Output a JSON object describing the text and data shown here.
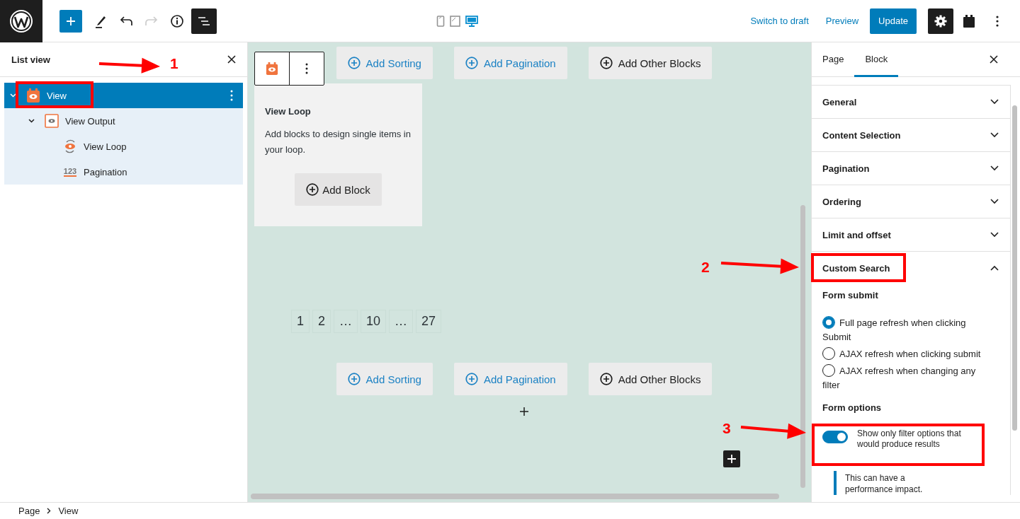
{
  "toolbar": {
    "redo": {
      "disabled": true
    },
    "list_view": {
      "on": true
    },
    "devices": [
      {
        "kind": "mobile",
        "selected": false
      },
      {
        "kind": "tablet",
        "selected": false
      },
      {
        "kind": "desktop",
        "selected": true
      }
    ],
    "actions": [
      {
        "label": "Switch to draft",
        "kind": "link"
      },
      {
        "label": "Preview",
        "kind": "link"
      },
      {
        "label": "Update",
        "kind": "primary"
      }
    ],
    "settings": {
      "on": true
    }
  },
  "list_view": {
    "title": "List view",
    "items": [
      {
        "label": "View",
        "kind": "view",
        "selected": true,
        "expanded": true,
        "children": [
          {
            "label": "View Output",
            "kind": "output",
            "selected": false,
            "expanded": true,
            "children": [
              {
                "label": "View Loop",
                "kind": "loop",
                "selected": false
              },
              {
                "label": "Pagination",
                "kind": "pagination",
                "icon_text": "123",
                "selected": false
              }
            ]
          }
        ]
      }
    ]
  },
  "canvas": {
    "top_buttons": [
      {
        "label": "Add Sorting",
        "kind": "accent"
      },
      {
        "label": "Add Pagination",
        "kind": "accent"
      },
      {
        "label": "Add Other Blocks",
        "kind": "plain"
      }
    ],
    "loop_card": {
      "title": "View Loop",
      "text": "Add blocks to design single items in your loop.",
      "button": "Add Block"
    },
    "pagination": [
      "1",
      "2",
      "…",
      "10",
      "…",
      "27"
    ],
    "bottom_buttons": [
      {
        "label": "Add Sorting",
        "kind": "accent"
      },
      {
        "label": "Add Pagination",
        "kind": "accent"
      },
      {
        "label": "Add Other Blocks",
        "kind": "plain"
      }
    ]
  },
  "sidebar": {
    "tabs": [
      {
        "label": "Page",
        "selected": false
      },
      {
        "label": "Block",
        "selected": true
      }
    ],
    "sections": [
      {
        "title": "General",
        "expanded": false
      },
      {
        "title": "Content Selection",
        "expanded": false
      },
      {
        "title": "Pagination",
        "expanded": false
      },
      {
        "title": "Ordering",
        "expanded": false
      },
      {
        "title": "Limit and offset",
        "expanded": false
      },
      {
        "title": "Custom Search",
        "expanded": true
      }
    ],
    "custom_search": {
      "form_submit": "Form submit",
      "radios": [
        {
          "label": "Full page refresh when clicking Submit",
          "selected": true
        },
        {
          "label": "AJAX refresh when clicking submit",
          "selected": false
        },
        {
          "label": "AJAX refresh when changing any filter",
          "selected": false
        }
      ],
      "form_options": "Form options",
      "toggle": {
        "label": "Show only filter options that would produce results",
        "on": true
      },
      "notice": "This can have a performance impact."
    }
  },
  "breadcrumb": [
    "Page",
    "View"
  ],
  "annotations": [
    {
      "label": "1"
    },
    {
      "label": "2"
    },
    {
      "label": "3"
    }
  ]
}
